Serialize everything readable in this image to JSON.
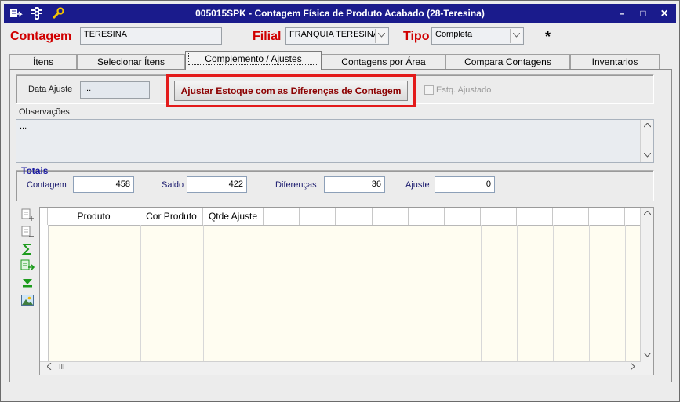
{
  "window": {
    "title": "005015SPK - Contagem Física de Produto Acabado (28-Teresina)",
    "minimize": "–",
    "maximize": "□",
    "close": "✕"
  },
  "header": {
    "contagem_label": "Contagem",
    "contagem_value": "TERESINA",
    "filial_label": "Filial",
    "filial_value": "FRANQUIA TERESINA",
    "tipo_label": "Tipo",
    "tipo_value": "Completa",
    "asterisk": "*"
  },
  "tabs": [
    {
      "label": "Ítens"
    },
    {
      "label": "Selecionar Ítens"
    },
    {
      "label": "Complemento / Ajustes"
    },
    {
      "label": "Contagens por Área"
    },
    {
      "label": "Compara Contagens"
    },
    {
      "label": "Inventarios"
    }
  ],
  "ajuste": {
    "data_label": "Data Ajuste",
    "data_value": "...",
    "button_label": "Ajustar Estoque com as Diferenças de Contagem",
    "checkbox_label": "Estq. Ajustado"
  },
  "observacoes": {
    "label": "Observações",
    "value": "..."
  },
  "totais": {
    "title": "Totais",
    "contagem_label": "Contagem",
    "contagem_value": "458",
    "saldo_label": "Saldo",
    "saldo_value": "422",
    "diferencas_label": "Diferenças",
    "diferencas_value": "36",
    "ajuste_label": "Ajuste",
    "ajuste_value": "0"
  },
  "grid": {
    "columns": [
      "Produto",
      "Cor Produto",
      "Qtde Ajuste"
    ],
    "hscroll_grip": "III"
  },
  "colors": {
    "title_bar": "#1a1b8c",
    "label_red": "#d00000",
    "highlight_border": "#e31b1b",
    "button_text": "#8b0000"
  }
}
